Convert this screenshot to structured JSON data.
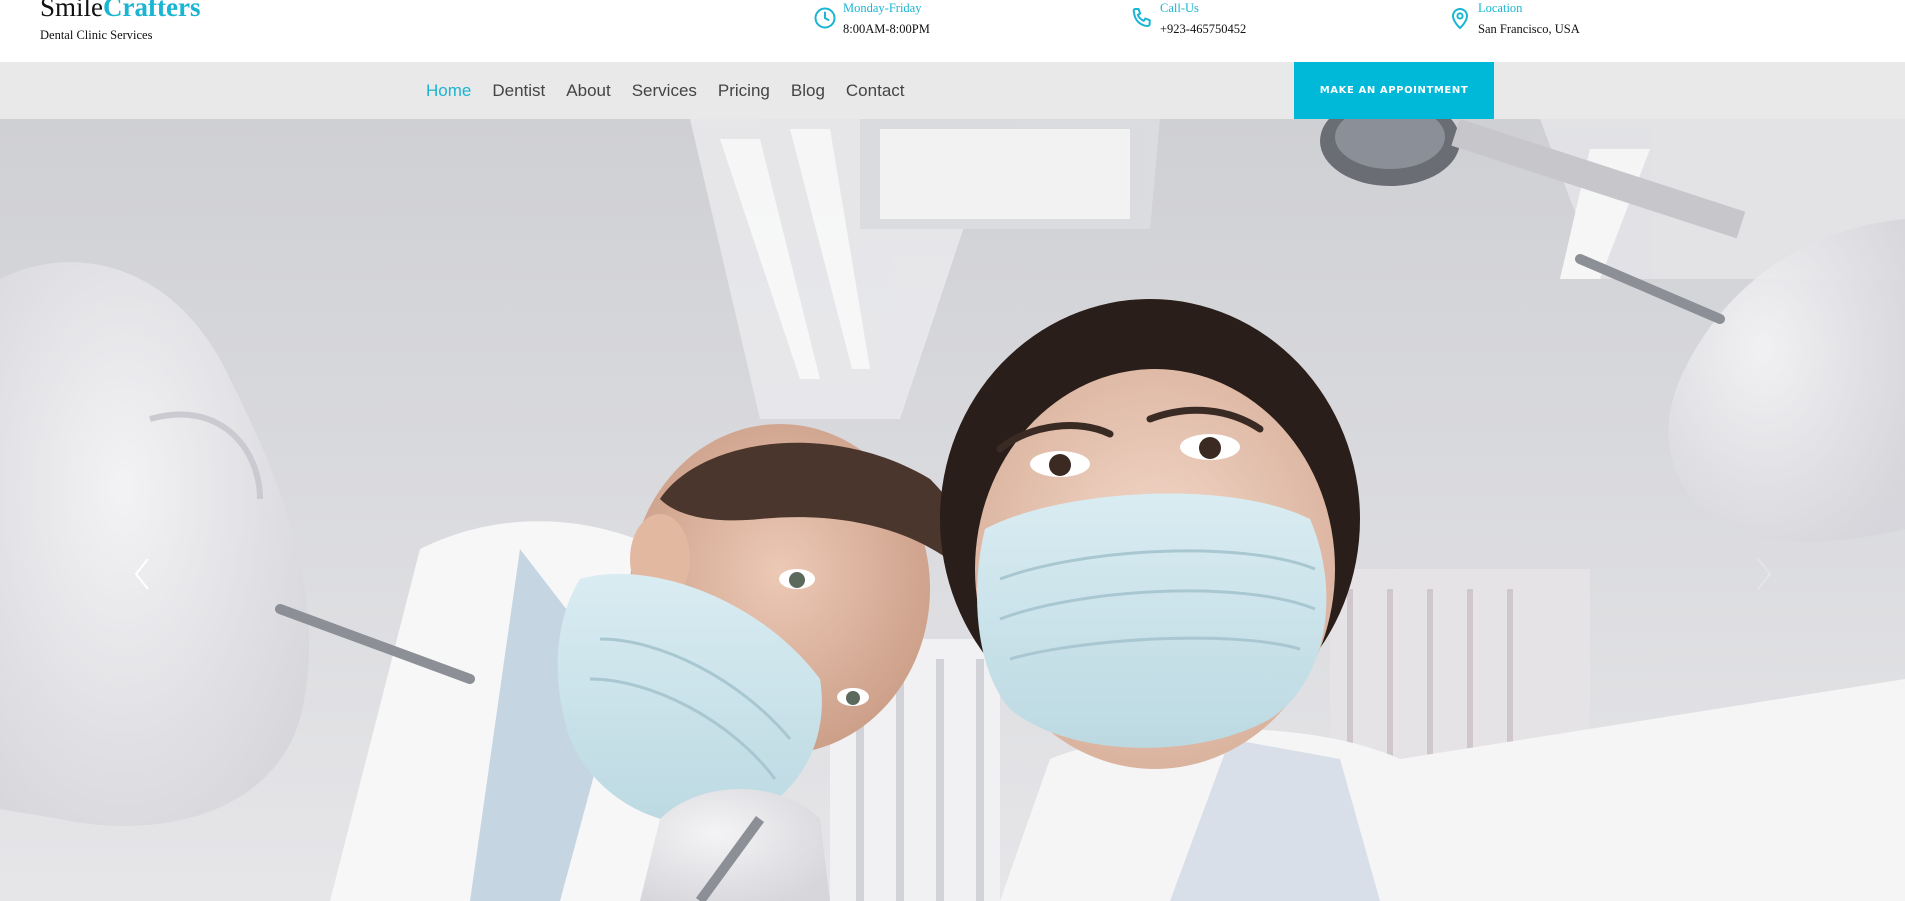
{
  "brand": {
    "name_part1": "Smile",
    "name_part2": "Crafters",
    "tagline": "Dental Clinic Services"
  },
  "info": {
    "hours": {
      "label": "Monday-Friday",
      "value": "8:00AM-8:00PM",
      "icon": "clock-icon"
    },
    "call": {
      "label": "Call-Us",
      "value": "+923-465750452",
      "icon": "phone-icon"
    },
    "location": {
      "label": "Location",
      "value": "San Francisco, USA",
      "icon": "map-pin-icon"
    }
  },
  "nav": {
    "items": [
      {
        "label": "Home",
        "active": true
      },
      {
        "label": "Dentist"
      },
      {
        "label": "About"
      },
      {
        "label": "Services"
      },
      {
        "label": "Pricing"
      },
      {
        "label": "Blog"
      },
      {
        "label": "Contact"
      }
    ]
  },
  "cta": {
    "label": "Make an Appointment"
  },
  "hero": {
    "prev_icon": "chevron-left-icon",
    "next_icon": "chevron-right-icon"
  },
  "colors": {
    "accent": "#1ab5d3",
    "cta_bg": "#00b8d8",
    "nav_bg": "#e9e9e9",
    "text_dark": "#111111"
  }
}
